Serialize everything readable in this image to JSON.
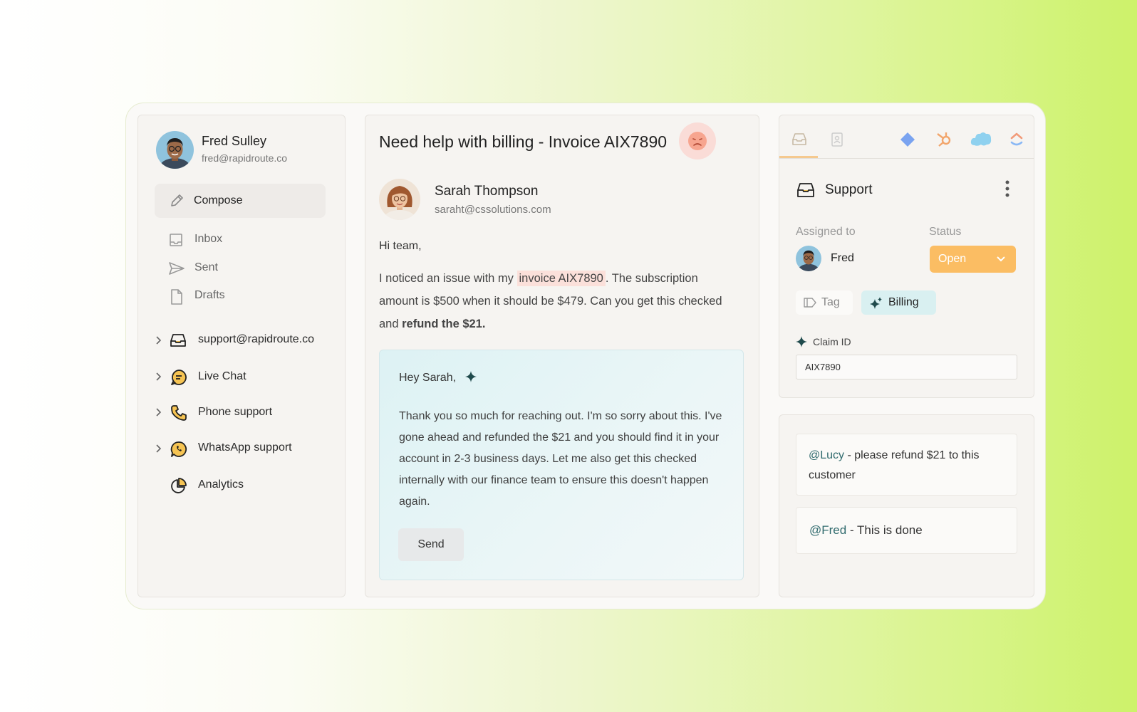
{
  "user": {
    "name": "Fred Sulley",
    "email": "fred@rapidroute.co"
  },
  "sidebar": {
    "compose_label": "Compose",
    "folders": [
      {
        "label": "Inbox",
        "icon": "inbox-icon"
      },
      {
        "label": "Sent",
        "icon": "send-icon"
      },
      {
        "label": "Drafts",
        "icon": "file-icon"
      }
    ],
    "channels": [
      {
        "label": "support@rapidroute.co",
        "icon": "inbox-tray-icon"
      },
      {
        "label": "Live Chat",
        "icon": "chat-icon"
      },
      {
        "label": "Phone support",
        "icon": "phone-icon"
      },
      {
        "label": "WhatsApp support",
        "icon": "whatsapp-icon"
      },
      {
        "label": "Analytics",
        "icon": "pie-chart-icon"
      }
    ]
  },
  "email": {
    "subject": "Need help with billing - Invoice AIX7890",
    "sentiment_icon": "frown-face-icon",
    "sender_name": "Sarah Thompson",
    "sender_email": "saraht@cssolutions.com",
    "greeting": "Hi team,",
    "body_part1": "I noticed an issue with my ",
    "body_highlight": "invoice AIX7890",
    "body_part2": ". The subscription amount is $500 when it should be $479. Can you get this checked and ",
    "body_bold": "refund the $21."
  },
  "reply": {
    "greeting": "Hey Sarah,",
    "body": "Thank you so much for reaching out. I'm so sorry about this. I've gone ahead and refunded the $21 and you should find it in your account in 2-3 business days. Let me also get this checked internally with our finance team to ensure this doesn't happen again.",
    "send_label": "Send"
  },
  "details": {
    "tabs": [
      "inbox-tab-icon",
      "contact-tab-icon",
      "diamond-app-icon",
      "hubspot-icon",
      "salesforce-icon",
      "clickup-icon"
    ],
    "section_title": "Support",
    "assigned_label": "Assigned to",
    "assignee": "Fred",
    "status_label": "Status",
    "status_value": "Open",
    "tag_label": "Tag",
    "billing_label": "Billing",
    "claim_label": "Claim ID",
    "claim_value": "AIX7890"
  },
  "notes": [
    {
      "mention": "@Lucy",
      "text": " - please refund $21 to this customer"
    },
    {
      "mention": "@Fred",
      "text": " - This is done"
    }
  ],
  "colors": {
    "status_open": "#fbbd63",
    "billing_chip": "#d9f0f1",
    "sentiment_bg": "#fadcd7",
    "highlight": "#fbe0da"
  }
}
